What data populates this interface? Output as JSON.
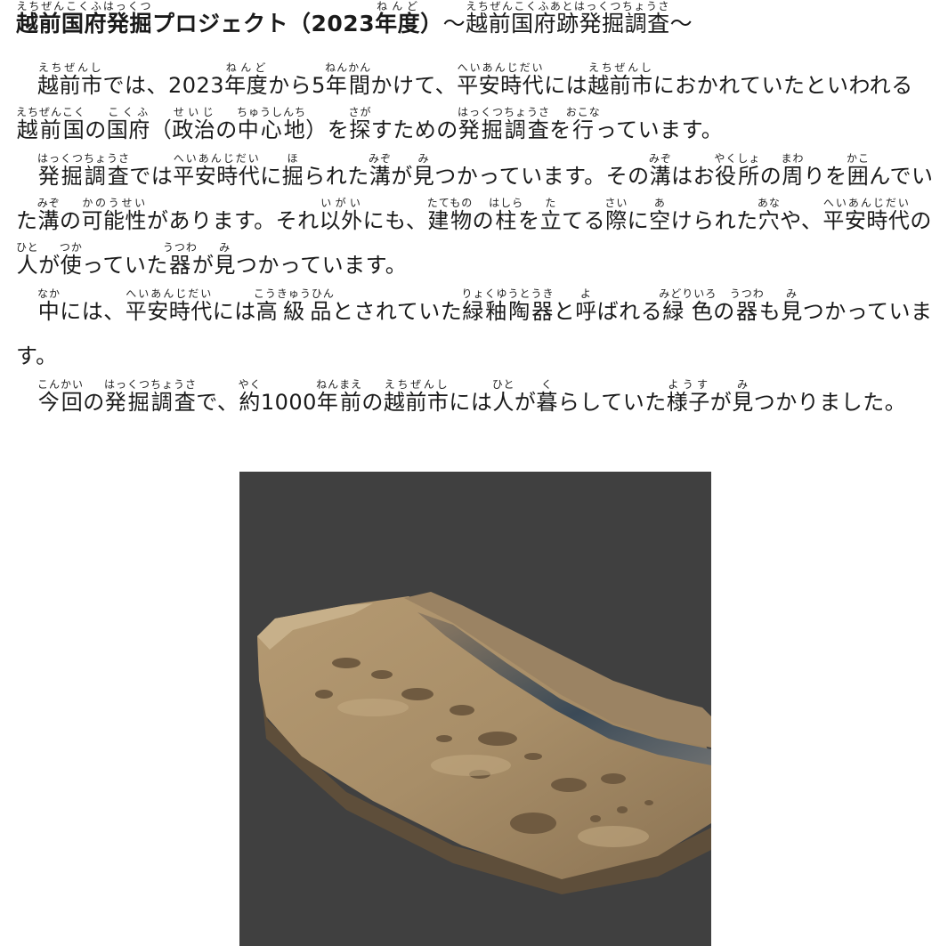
{
  "title": {
    "main": [
      {
        "t": "越前国府発掘",
        "r": "えちぜんこくふはっくつ"
      },
      {
        "t": "プロジェクト（2023"
      },
      {
        "t": "年度",
        "r": "ねんど"
      },
      {
        "t": "）"
      }
    ],
    "sub": [
      {
        "t": "～"
      },
      {
        "t": "越前国府跡発掘調査",
        "r": "えちぜんこくふあとはっくつちょうさ"
      },
      {
        "t": "～"
      }
    ]
  },
  "paragraphs": [
    [
      {
        "t": "越前市",
        "r": "えちぜんし"
      },
      {
        "t": "では、2023"
      },
      {
        "t": "年度",
        "r": "ねんど"
      },
      {
        "t": "から5"
      },
      {
        "t": "年間",
        "r": "ねんかん"
      },
      {
        "t": "かけて、"
      },
      {
        "t": "平安時代",
        "r": "へいあんじだい"
      },
      {
        "t": "には"
      },
      {
        "t": "越前市",
        "r": "えちぜんし"
      },
      {
        "t": "におかれていたといわれる"
      },
      {
        "t": "越前国",
        "r": "えちぜんこく"
      },
      {
        "t": "の"
      },
      {
        "t": "国府",
        "r": "こくふ"
      },
      {
        "t": "（"
      },
      {
        "t": "政治",
        "r": "せいじ"
      },
      {
        "t": "の"
      },
      {
        "t": "中心地",
        "r": "ちゅうしんち"
      },
      {
        "t": "）を"
      },
      {
        "t": "探",
        "r": "さが"
      },
      {
        "t": "すための"
      },
      {
        "t": "発掘調査",
        "r": "はっくつちょうさ"
      },
      {
        "t": "を"
      },
      {
        "t": "行",
        "r": "おこな"
      },
      {
        "t": "っています。"
      }
    ],
    [
      {
        "t": "発掘調査",
        "r": "はっくつちょうさ"
      },
      {
        "t": "では"
      },
      {
        "t": "平安時代",
        "r": "へいあんじだい"
      },
      {
        "t": "に"
      },
      {
        "t": "掘",
        "r": "ほ"
      },
      {
        "t": "られた"
      },
      {
        "t": "溝",
        "r": "みぞ"
      },
      {
        "t": "が"
      },
      {
        "t": "見",
        "r": "み"
      },
      {
        "t": "つかっています。その"
      },
      {
        "t": "溝",
        "r": "みぞ"
      },
      {
        "t": "はお"
      },
      {
        "t": "役所",
        "r": "やくしょ"
      },
      {
        "t": "の"
      },
      {
        "t": "周",
        "r": "まわ"
      },
      {
        "t": "りを"
      },
      {
        "t": "囲",
        "r": "かこ"
      },
      {
        "t": "んでいた"
      },
      {
        "t": "溝",
        "r": "みぞ"
      },
      {
        "t": "の"
      },
      {
        "t": "可能性",
        "r": "かのうせい"
      },
      {
        "t": "があります。それ"
      },
      {
        "t": "以外",
        "r": "いがい"
      },
      {
        "t": "にも、"
      },
      {
        "t": "建物",
        "r": "たてもの"
      },
      {
        "t": "の"
      },
      {
        "t": "柱",
        "r": "はしら"
      },
      {
        "t": "を"
      },
      {
        "t": "立",
        "r": "た"
      },
      {
        "t": "てる"
      },
      {
        "t": "際",
        "r": "さい"
      },
      {
        "t": "に"
      },
      {
        "t": "空",
        "r": "あ"
      },
      {
        "t": "けられた"
      },
      {
        "t": "穴",
        "r": "あな"
      },
      {
        "t": "や、"
      },
      {
        "t": "平安時代",
        "r": "へいあんじだい"
      },
      {
        "t": "の"
      },
      {
        "t": "人",
        "r": "ひと"
      },
      {
        "t": "が"
      },
      {
        "t": "使",
        "r": "つか"
      },
      {
        "t": "っていた"
      },
      {
        "t": "器",
        "r": "うつわ"
      },
      {
        "t": "が"
      },
      {
        "t": "見",
        "r": "み"
      },
      {
        "t": "つかっています。"
      }
    ],
    [
      {
        "t": "中",
        "r": "なか"
      },
      {
        "t": "には、"
      },
      {
        "t": "平安時代",
        "r": "へいあんじだい"
      },
      {
        "t": "には"
      },
      {
        "t": "高級品",
        "r": "こうきゅうひん"
      },
      {
        "t": "とされていた"
      },
      {
        "t": "緑釉陶器",
        "r": "りょくゆうとうき"
      },
      {
        "t": "と"
      },
      {
        "t": "呼",
        "r": "よ"
      },
      {
        "t": "ばれる"
      },
      {
        "t": "緑色",
        "r": "みどりいろ"
      },
      {
        "t": "の"
      },
      {
        "t": "器",
        "r": "うつわ"
      },
      {
        "t": "も"
      },
      {
        "t": "見",
        "r": "み"
      },
      {
        "t": "つかっています。"
      }
    ],
    [
      {
        "t": "今回",
        "r": "こんかい"
      },
      {
        "t": "の"
      },
      {
        "t": "発掘調査",
        "r": "はっくつちょうさ"
      },
      {
        "t": "で、"
      },
      {
        "t": "約",
        "r": "やく"
      },
      {
        "t": "1000"
      },
      {
        "t": "年前",
        "r": "ねんまえ"
      },
      {
        "t": "の"
      },
      {
        "t": "越前市",
        "r": "えちぜんし"
      },
      {
        "t": "には"
      },
      {
        "t": "人",
        "r": "ひと"
      },
      {
        "t": "が"
      },
      {
        "t": "暮",
        "r": "く"
      },
      {
        "t": "らしていた"
      },
      {
        "t": "様子",
        "r": "ようす"
      },
      {
        "t": "が"
      },
      {
        "t": "見",
        "r": "み"
      },
      {
        "t": "つかりました。"
      }
    ]
  ],
  "photo": {
    "background_color": "#404040",
    "soil_color": "#a88e68",
    "soil_dark_color": "#6f5a40",
    "shadow_color": "#3b4a57"
  }
}
